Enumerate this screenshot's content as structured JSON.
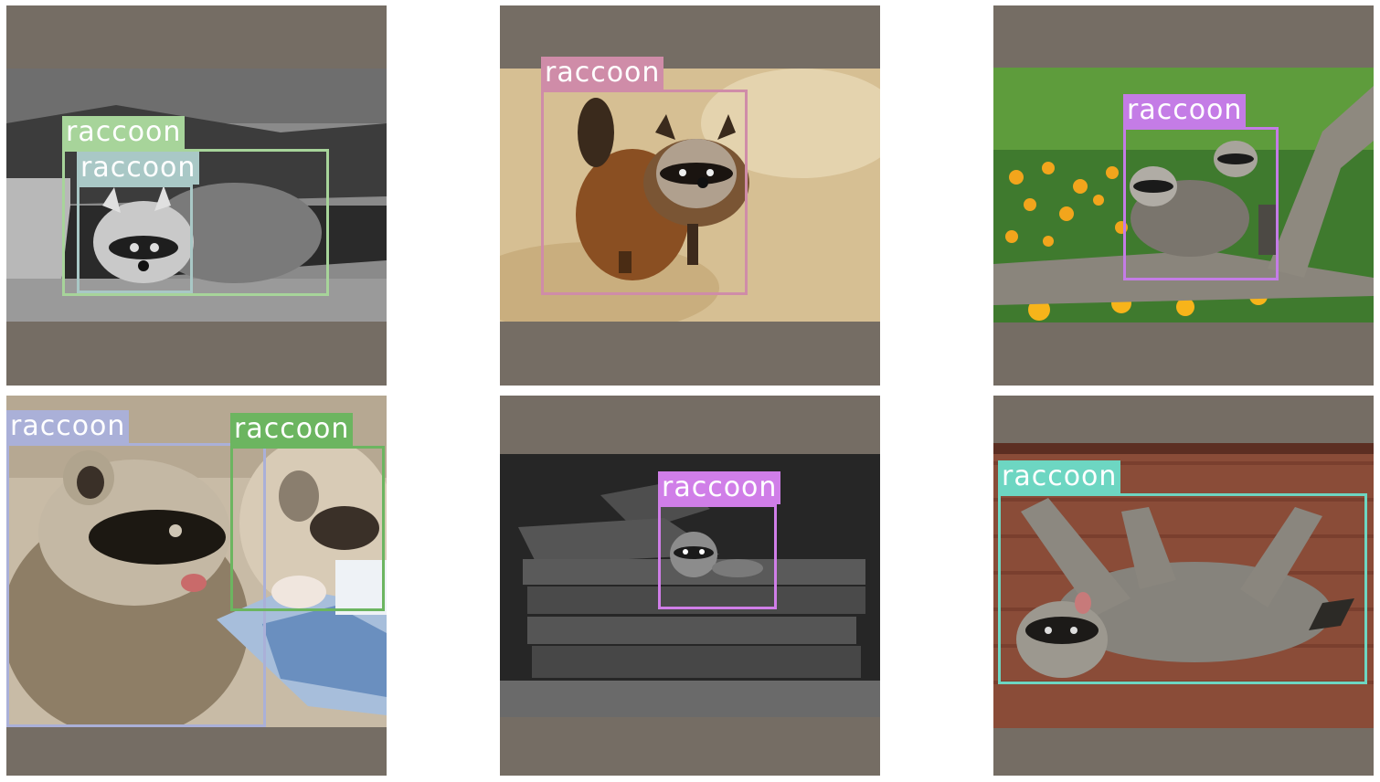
{
  "panels": [
    {
      "detections": [
        {
          "label": "raccoon",
          "color": "#a7d49a"
        },
        {
          "label": "raccoon",
          "color": "#a9c8c6"
        }
      ]
    },
    {
      "detections": [
        {
          "label": "raccoon",
          "color": "#cf8ca8"
        }
      ]
    },
    {
      "detections": [
        {
          "label": "raccoon",
          "color": "#c47ce6"
        }
      ]
    },
    {
      "detections": [
        {
          "label": "raccoon",
          "color": "#aab0d8"
        },
        {
          "label": "raccoon",
          "color": "#6cb560"
        }
      ]
    },
    {
      "detections": [
        {
          "label": "raccoon",
          "color": "#d07ee8"
        }
      ]
    },
    {
      "detections": [
        {
          "label": "raccoon",
          "color": "#6dd6c2"
        }
      ]
    }
  ]
}
